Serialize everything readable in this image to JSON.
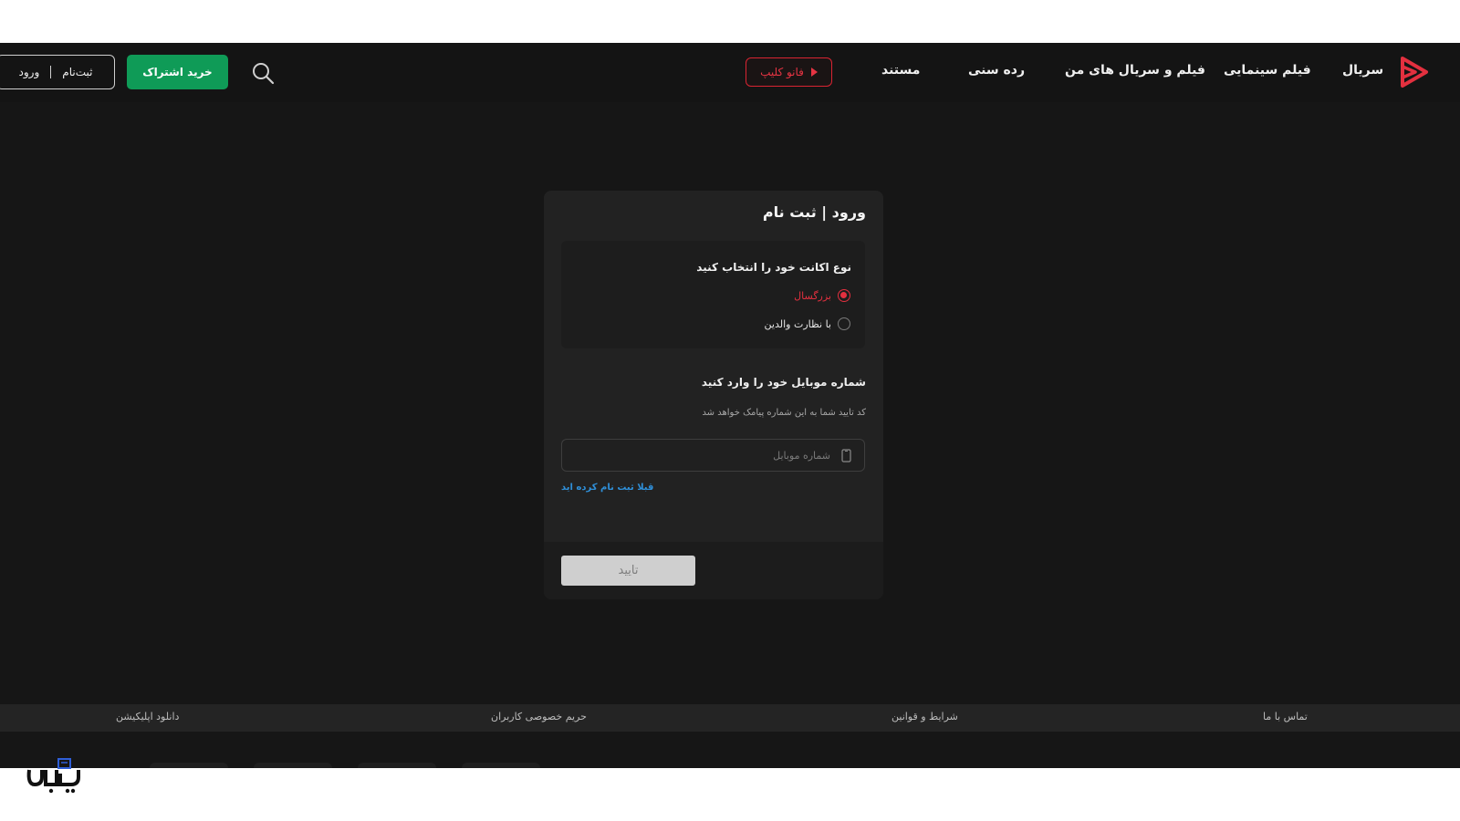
{
  "header": {
    "nav": [
      "سریال",
      "فیلم سینمایی",
      "فیلم و سریال های من",
      "رده سنی",
      "مستند"
    ],
    "clip_label": "فانو کلیپ",
    "buy_label": "خرید اشتراک",
    "signup_label": "ثبت‌نام",
    "login_label": "ورود"
  },
  "card": {
    "title": "ورود | ثبت نام",
    "account_type_label": "نوع اکانت خود را انتخاب کنید",
    "options": [
      {
        "label": "بزرگسال",
        "selected": true
      },
      {
        "label": "با نظارت والدین",
        "selected": false
      }
    ],
    "mobile_label": "شماره موبایل خود را وارد کنید",
    "mobile_hint": "کد تایید شما به این شماره پیامک خواهد شد",
    "mobile_placeholder": "شماره موبایل",
    "registered_link": "قبلا ثبت نام کرده اید",
    "confirm_label": "تایید"
  },
  "footer": {
    "links": [
      "تماس با ما",
      "شرایط و قوانین",
      "حریم خصوصی کاربران",
      "دانلود اپلیکیشن"
    ]
  },
  "watermark": {
    "text": "اِی‌بازی"
  },
  "colors": {
    "accent_red": "#e3303f",
    "buy_green": "#0f9b57",
    "link_blue": "#2f8fd8",
    "background": "#161616"
  }
}
